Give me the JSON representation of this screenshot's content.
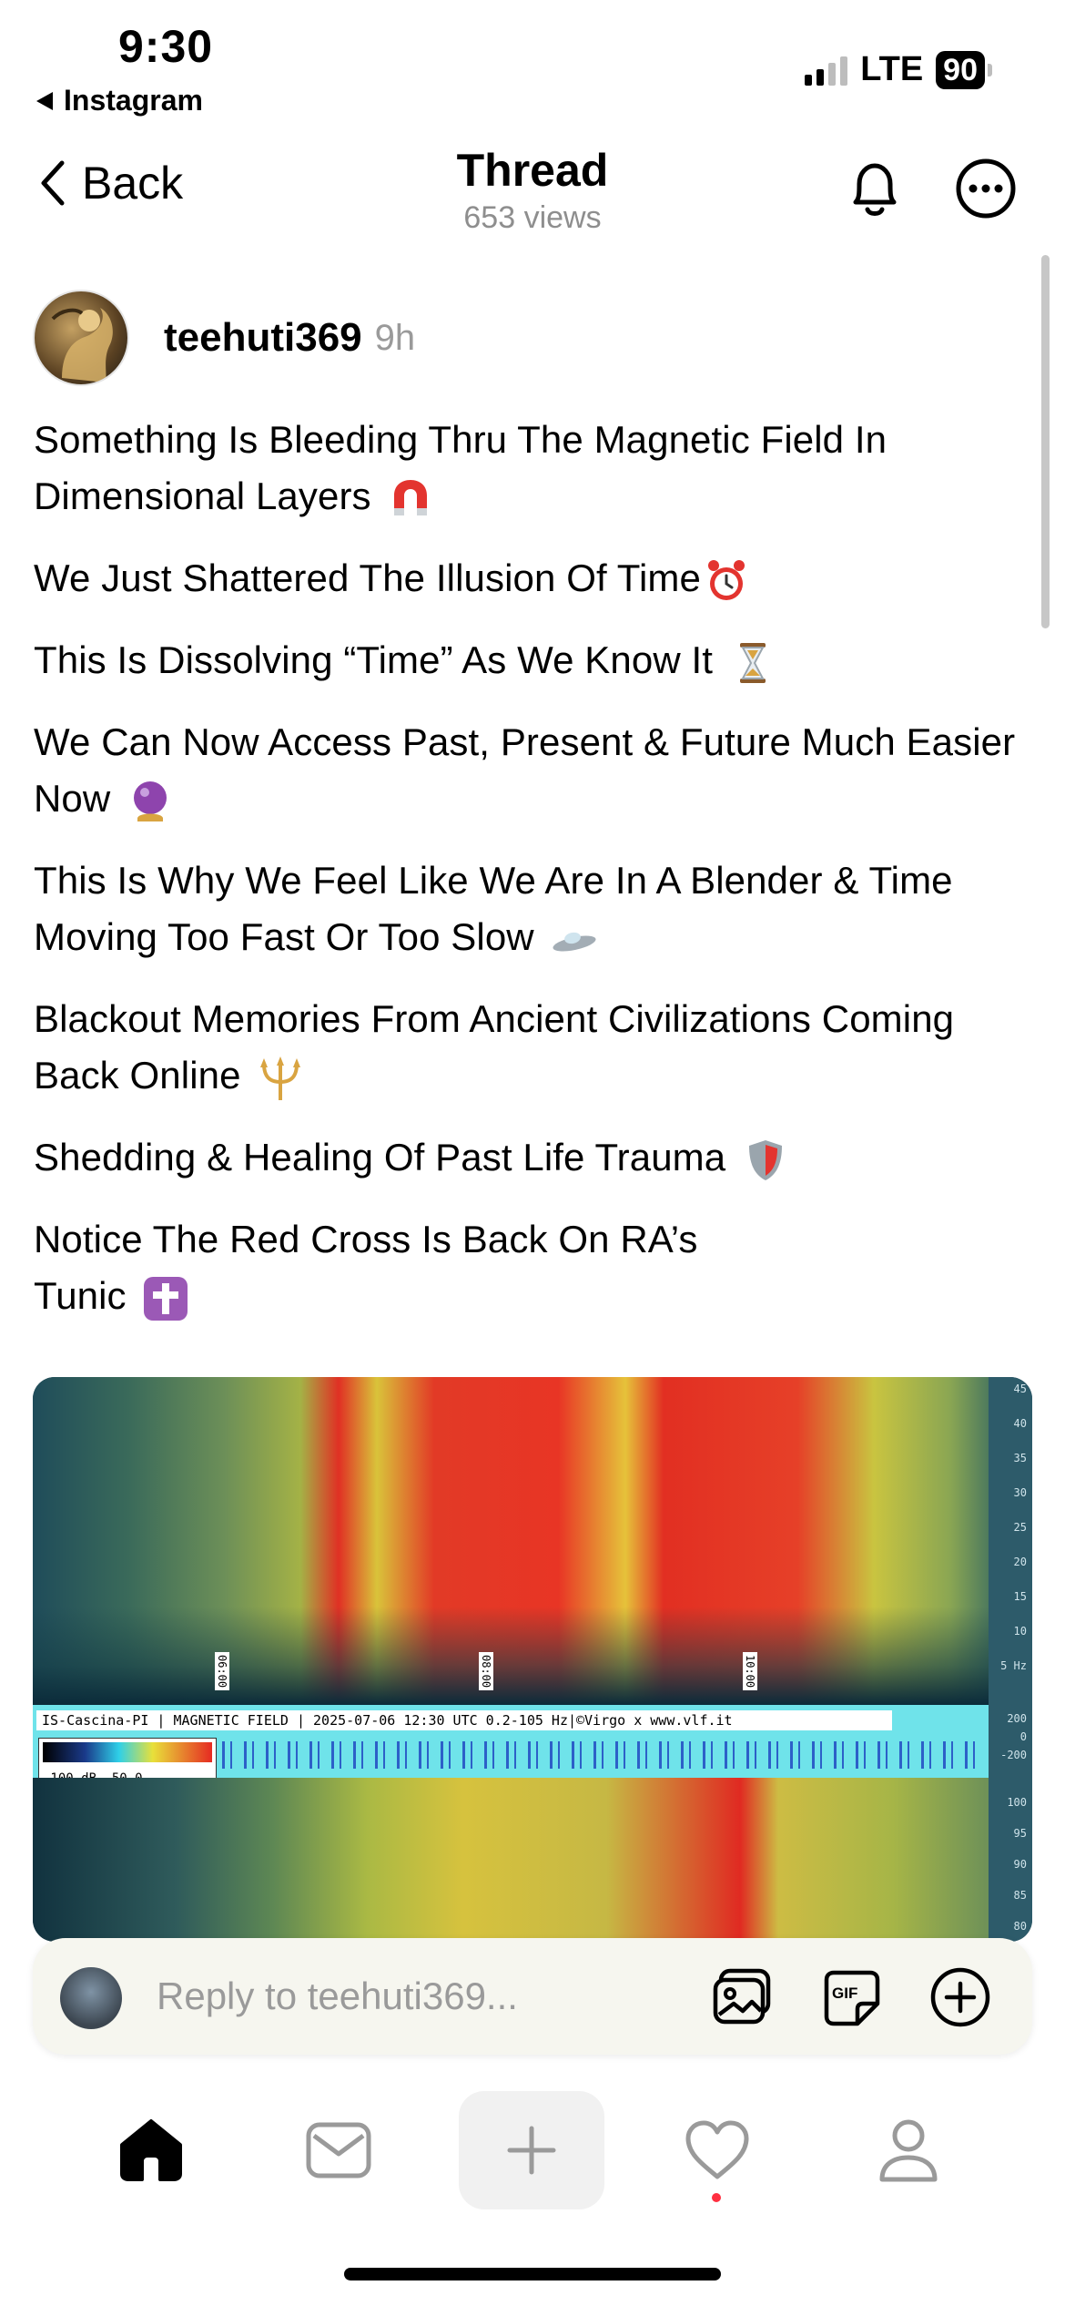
{
  "status_bar": {
    "time": "9:30",
    "back_app": "Instagram",
    "network": "LTE",
    "battery": "90"
  },
  "header": {
    "back_label": "Back",
    "title": "Thread",
    "views": "653 views"
  },
  "post": {
    "username": "teehuti369",
    "time_ago": "9h",
    "lines": [
      {
        "text": "Something Is Bleeding Thru The Magnetic Field In Dimensional Layers",
        "emoji": "magnet-icon"
      },
      {
        "text": "We Just Shattered The Illusion Of Time",
        "emoji": "alarm-clock-icon"
      },
      {
        "text": "This Is Dissolving “Time” As We Know It",
        "emoji": "hourglass-icon"
      },
      {
        "text": "We Can Now Access Past, Present & Future Much Easier Now",
        "emoji": "crystal-ball-icon"
      },
      {
        "text": "This Is Why We Feel Like We Are In A Blender & Time Moving Too Fast Or Too Slow",
        "emoji": "flying-saucer-icon"
      },
      {
        "text": "Blackout Memories From Ancient Civilizations Coming Back Online",
        "emoji": "trident-icon"
      },
      {
        "text": "Shedding & Healing Of Past Life Trauma",
        "emoji": "shield-icon"
      },
      {
        "text": "Notice The Red Cross Is Back On RA’s Tunic",
        "emoji": "cross-icon"
      }
    ],
    "image": {
      "label": "IS-Cascina-PI | MAGNETIC FIELD | 2025-07-06 12:30 UTC 0.2-105 Hz|©Virgo x www.vlf.it",
      "scale": "-100 dB   -50      0",
      "time_marks": [
        "06:00",
        "08:00",
        "10:00"
      ],
      "axis_top": [
        "45",
        "40",
        "35",
        "30",
        "25",
        "20",
        "15",
        "10",
        "5 Hz"
      ],
      "axis_mid": [
        "200",
        "0",
        "-200"
      ],
      "axis_bottom": [
        "100",
        "95",
        "90",
        "85",
        "80"
      ]
    }
  },
  "reply": {
    "placeholder": "Reply to teehuti369..."
  },
  "colors": {
    "accent_notification": "#ff2f40",
    "muted_text": "#8e8e8e"
  },
  "tabs": [
    "home-icon",
    "messages-icon",
    "create-icon",
    "activity-icon",
    "profile-icon"
  ]
}
